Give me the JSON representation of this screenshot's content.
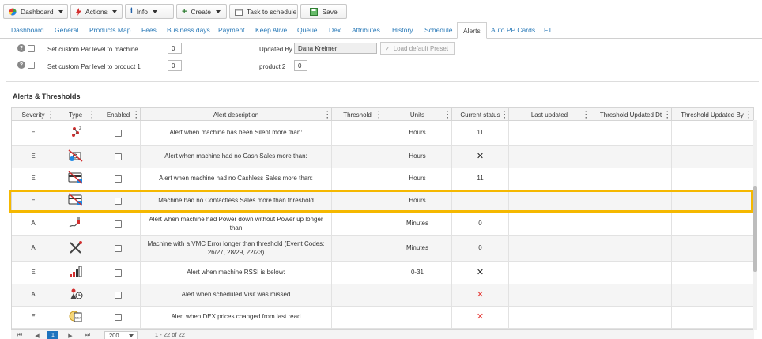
{
  "toolbar": {
    "dashboard": "Dashboard",
    "actions": "Actions",
    "info": "Info",
    "create": "Create",
    "task": "Task to schedule",
    "save": "Save"
  },
  "tabs": [
    "Dashboard",
    "General",
    "Products Map",
    "Fees",
    "Business days",
    "Payment",
    "Keep Alive",
    "Queue",
    "Dex",
    "Attributes",
    "History",
    "Schedule",
    "Alerts",
    "Auto PP Cards",
    "FTL"
  ],
  "active_tab": "Alerts",
  "settings": {
    "par_machine_label": "Set custom Par level to machine",
    "par_machine_value": "0",
    "par_product1_label": "Set custom Par level to product 1",
    "par_product1_value": "0",
    "updated_by_label": "Updated By",
    "updated_by_value": "Dana Kreimer",
    "load_preset": "Load default Preset",
    "product2_label": "product 2",
    "product2_value": "0"
  },
  "section_title": "Alerts & Thresholds",
  "columns": [
    "Severity",
    "Type",
    "Enabled",
    "Alert description",
    "Threshold",
    "Units",
    "Current status",
    "Last updated",
    "Threshold Updated Dt",
    "Threshold Updated By"
  ],
  "rows": [
    {
      "severity": "E",
      "type_icon": "silent-icon",
      "description": "Alert when machine has been Silent more than:",
      "threshold": "",
      "units": "Hours",
      "status": "11",
      "status_kind": "text"
    },
    {
      "severity": "E",
      "type_icon": "cash-sales-icon",
      "description": "Alert when machine had no Cash Sales more than:",
      "threshold": "",
      "units": "Hours",
      "status": "✕",
      "status_kind": "x"
    },
    {
      "severity": "E",
      "type_icon": "cashless-sales-icon",
      "description": "Alert when machine had no Cashless Sales more than:",
      "threshold": "",
      "units": "Hours",
      "status": "11",
      "status_kind": "text"
    },
    {
      "severity": "E",
      "type_icon": "contactless-sales-icon",
      "description": "Machine had no Contactless Sales more than threshold",
      "threshold": "",
      "units": "Hours",
      "status": "",
      "status_kind": "text"
    },
    {
      "severity": "A",
      "type_icon": "power-plug-icon",
      "description": "Alert when machine had Power down without Power up longer than",
      "threshold": "",
      "units": "Minutes",
      "status": "0",
      "status_kind": "text"
    },
    {
      "severity": "A",
      "type_icon": "tools-icon",
      "description": "Machine with a VMC Error longer than threshold (Event Codes: 26/27, 28/29, 22/23)",
      "threshold": "",
      "units": "Minutes",
      "status": "0",
      "status_kind": "text"
    },
    {
      "severity": "E",
      "type_icon": "signal-bars-icon",
      "description": "Alert when machine RSSI is below:",
      "threshold": "",
      "units": "0-31",
      "status": "✕",
      "status_kind": "x"
    },
    {
      "severity": "A",
      "type_icon": "missed-visit-icon",
      "description": "Alert when scheduled Visit was missed",
      "threshold": "",
      "units": "",
      "status": "✕",
      "status_kind": "redx"
    },
    {
      "severity": "E",
      "type_icon": "dex-price-icon",
      "description": "Alert when DEX prices changed from last read",
      "threshold": "",
      "units": "",
      "status": "✕",
      "status_kind": "redx"
    }
  ],
  "pager": {
    "first": "⏮",
    "prev": "◀",
    "current_page": "1",
    "next": "▶",
    "last": "⏭",
    "page_size": "200",
    "info": "1 - 22 of 22"
  },
  "colors": {
    "link": "#2a7ab8",
    "highlight": "#f5b800",
    "pager_active": "#1e73be",
    "red_x": "#e53935"
  }
}
